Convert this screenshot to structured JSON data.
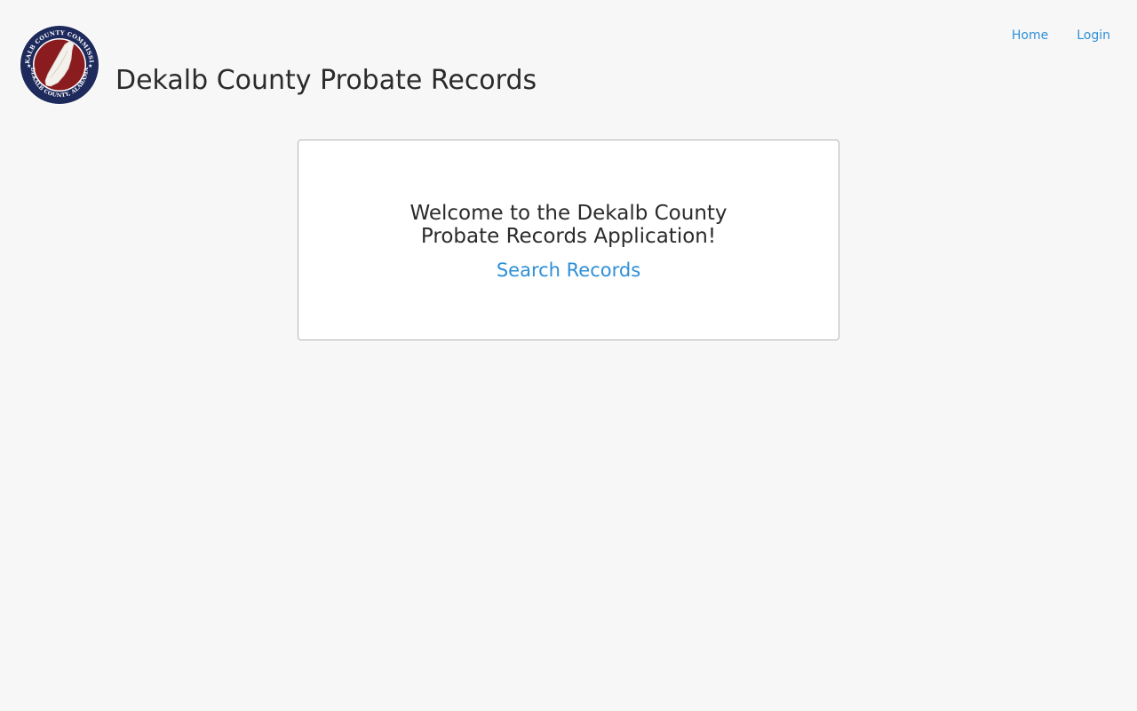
{
  "header": {
    "site_title": "Dekalb County Probate Records",
    "logo_top_text": "DEKALB COUNTY COMMISSION",
    "logo_bottom_text": "DEKALB COUNTY, ALABAMA",
    "logo_icon": "county-seal-icon"
  },
  "nav": {
    "items": [
      {
        "label": "Home"
      },
      {
        "label": "Login"
      }
    ]
  },
  "main": {
    "welcome_text": "Welcome to the Dekalb County Probate Records Application!",
    "search_link_label": "Search Records"
  },
  "colors": {
    "background": "#f7f7f7",
    "link": "#2e8fd6",
    "seal_navy": "#1d2a5b",
    "seal_red": "#8a1c1f",
    "card_border": "#b5b5b5"
  }
}
